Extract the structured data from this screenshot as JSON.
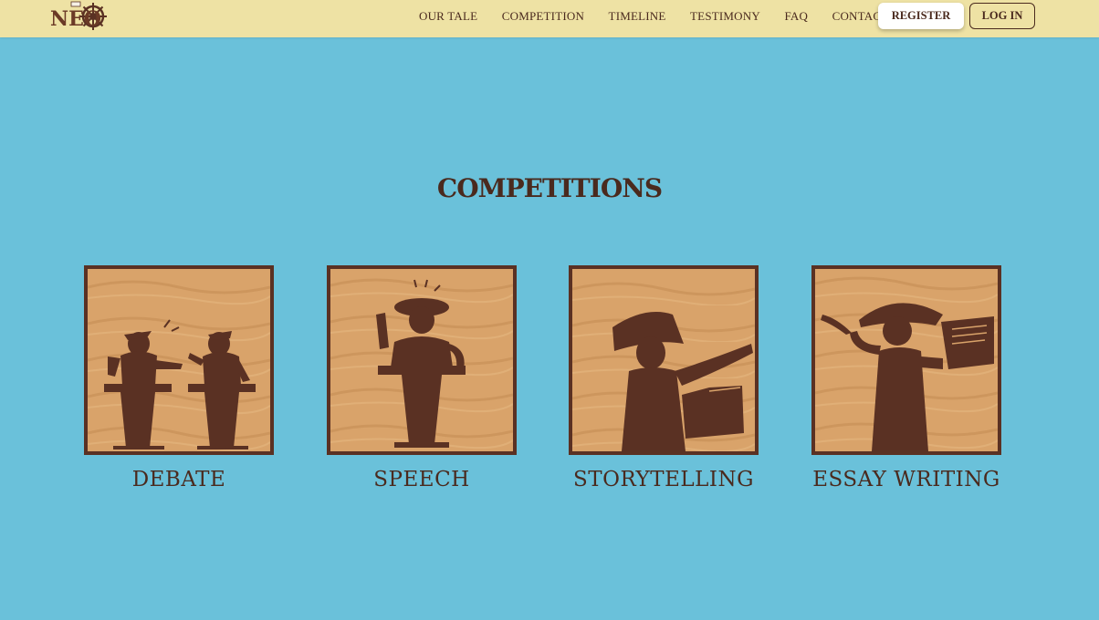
{
  "brand": {
    "logo_text": "NEO"
  },
  "nav": {
    "links": [
      "OUR TALE",
      "COMPETITION",
      "TIMELINE",
      "TESTIMONY",
      "FAQ",
      "CONTACT"
    ],
    "register_label": "REGISTER",
    "login_label": "LOG IN"
  },
  "competitions": {
    "title": "COMPETITIONS",
    "items": [
      {
        "label": "DEBATE",
        "icon": "debate-illustration-icon"
      },
      {
        "label": "SPEECH",
        "icon": "speech-illustration-icon"
      },
      {
        "label": "STORYTELLING",
        "icon": "storytelling-illustration-icon"
      },
      {
        "label": "ESSAY WRITING",
        "icon": "essay-writing-illustration-icon"
      }
    ]
  },
  "colors": {
    "background": "#6ac1da",
    "navbar": "#eee2a4",
    "brown": "#4a2a1e",
    "wood": "#d9a36a"
  }
}
